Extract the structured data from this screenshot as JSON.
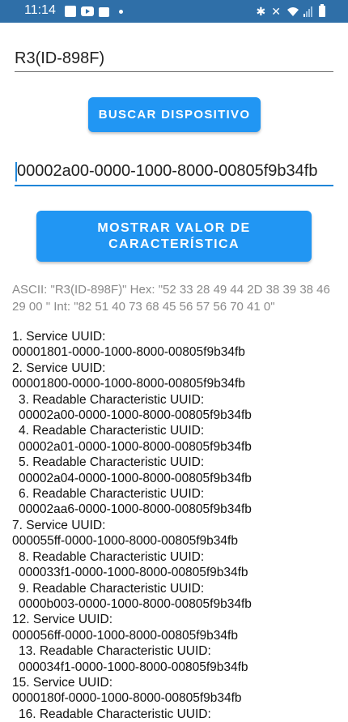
{
  "status_bar": {
    "time": "11:14",
    "icons_left": [
      "square-notification-icon",
      "youtube-icon",
      "bag-icon",
      "dot-icon"
    ],
    "icons_right": [
      "bluetooth-icon",
      "mute-icon",
      "wifi-icon",
      "signal-icon",
      "battery-icon"
    ]
  },
  "device_name": "R3(ID-898F)",
  "search_button": "BUSCAR DISPOSITIVO",
  "uuid_input": "00002a00-0000-1000-8000-00805f9b34fb",
  "show_button": {
    "line1": "MOSTRAR VALOR DE",
    "line2": "CARACTERÍSTICA"
  },
  "ascii_result": "ASCII: \"R3(ID-898F)\" Hex: \"52 33 28 49 44 2D 38 39 38 46 29 00 \" Int: \"82 51 40 73 68 45 56 57 56 70 41 0\"",
  "services": [
    {
      "title": "1. Service UUID:",
      "uuid": "00001801-0000-1000-8000-00805f9b34fb",
      "indent": false
    },
    {
      "title": "2. Service UUID:",
      "uuid": "00001800-0000-1000-8000-00805f9b34fb",
      "indent": false
    },
    {
      "title": "3. Readable Characteristic UUID:",
      "uuid": "00002a00-0000-1000-8000-00805f9b34fb",
      "indent": true
    },
    {
      "title": "4. Readable Characteristic UUID:",
      "uuid": "00002a01-0000-1000-8000-00805f9b34fb",
      "indent": true
    },
    {
      "title": "5. Readable Characteristic UUID:",
      "uuid": "00002a04-0000-1000-8000-00805f9b34fb",
      "indent": true
    },
    {
      "title": "6. Readable Characteristic UUID:",
      "uuid": "00002aa6-0000-1000-8000-00805f9b34fb",
      "indent": true
    },
    {
      "title": "7. Service UUID:",
      "uuid": "000055ff-0000-1000-8000-00805f9b34fb",
      "indent": false
    },
    {
      "title": "8. Readable Characteristic UUID:",
      "uuid": "000033f1-0000-1000-8000-00805f9b34fb",
      "indent": true
    },
    {
      "title": "9. Readable Characteristic UUID:",
      "uuid": "0000b003-0000-1000-8000-00805f9b34fb",
      "indent": true
    },
    {
      "title": "12. Service UUID:",
      "uuid": "000056ff-0000-1000-8000-00805f9b34fb",
      "indent": false
    },
    {
      "title": "13. Readable Characteristic UUID:",
      "uuid": "000034f1-0000-1000-8000-00805f9b34fb",
      "indent": true
    },
    {
      "title": "15. Service UUID:",
      "uuid": "0000180f-0000-1000-8000-00805f9b34fb",
      "indent": false
    },
    {
      "title": "16. Readable Characteristic UUID:",
      "uuid": "",
      "indent": true
    }
  ]
}
